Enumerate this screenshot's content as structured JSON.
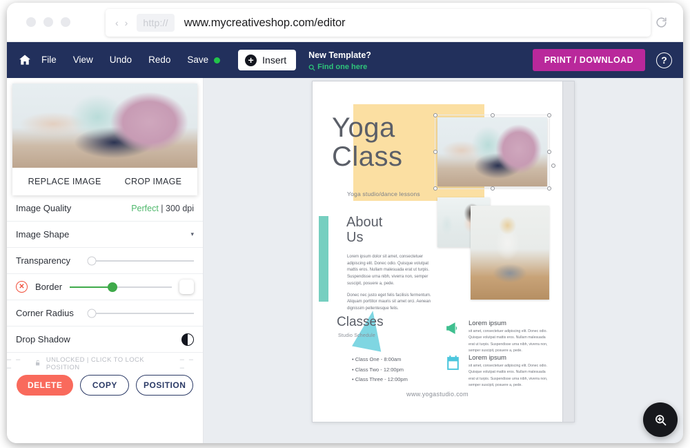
{
  "browser": {
    "back_icon": "chevron-left-icon",
    "forward_icon": "chevron-right-icon",
    "scheme_chip": "http://",
    "url": "www.mycreativeshop.com/editor",
    "reload_icon": "reload-icon"
  },
  "toolbar": {
    "home_icon": "home-icon",
    "menu": [
      {
        "label": "File"
      },
      {
        "label": "View"
      },
      {
        "label": "Undo"
      },
      {
        "label": "Redo"
      }
    ],
    "save_label": "Save",
    "save_status_color": "#22c44a",
    "insert_label": "Insert",
    "template_title": "New Template?",
    "template_link": "Find one here",
    "print_label": "PRINT / DOWNLOAD",
    "help_label": "?",
    "bg_color": "#22305c",
    "accent_color": "#b9289b",
    "link_color": "#2ec47a"
  },
  "panel": {
    "replace_label": "REPLACE IMAGE",
    "crop_label": "CROP IMAGE",
    "rows": [
      {
        "label": "Image Quality",
        "value_ok": "Perfect",
        "value_rest": " | 300 dpi"
      },
      {
        "label": "Image Shape",
        "caret": "▾"
      },
      {
        "label": "Transparency",
        "slider_percent": 0
      },
      {
        "label": "Border",
        "slider_percent": 42
      },
      {
        "label": "Corner Radius",
        "slider_percent": 0
      },
      {
        "label": "Drop Shadow"
      }
    ],
    "border_disable_icon": "no-color-icon",
    "border_swatch_color": "#ffffff",
    "lock_text": "UNLOCKED | CLICK TO LOCK POSITION",
    "lock_dashes_left": "–  –  –",
    "lock_dashes_right": "–  –  –",
    "buttons": {
      "delete": "DELETE",
      "copy": "COPY",
      "position": "POSITION"
    },
    "delete_color": "#f96a5c",
    "outline_color": "#2b3a66"
  },
  "flyer": {
    "title_line1": "Yoga",
    "title_line2": "Class",
    "subtitle": "Yoga studio/dance lessons",
    "about_title_line1": "About",
    "about_title_line2": "Us",
    "about_p1": "Lorem ipsum dolor sit amet, consectetuer adipiscing elit. Donec odio. Quisque volutpat mattis eros. Nullam malesuada erat ut turpis. Suspendisse urna nibh, viverra non, semper suscipit, posuere a, pede.",
    "about_p2": "Donec nec justo eget felis facilisis fermentum. Aliquam porttitor mauris sit amet orci. Aenean dignissim pellentesque felis.",
    "classes_title": "Classes",
    "classes_sub": "Studio Schedule",
    "class_items": [
      "• Class One - 8:00am",
      "• Class Two - 12:00pm",
      "• Class Three - 12:00pm"
    ],
    "features": [
      {
        "icon": "megaphone-icon",
        "title": "Lorem ipsum",
        "text": " sit amet, consectetuer adipiscing elit. Donec odio. Quisque volutpat mattis eros. Nullam malesuada erat ut turpis. Suspendisse urna nibh, viverra non, semper suscipit, posuere a, pede."
      },
      {
        "icon": "calendar-icon",
        "title": "Lorem ipsum",
        "text": " sit amet, consectetuer adipiscing elit. Donec odio. Quisque volutpat mattis eros. Nullam malesuada erat ut turpis. Suspendisse urna nibh, viverra non, semper suscipit, posuere a, pede."
      }
    ],
    "website": "www.yogastudio.com",
    "yellow_color": "#fbdfa2",
    "teal_color": "#76cfc0",
    "triangle_color": "#74d2e0"
  },
  "fab": {
    "icon": "zoom-in-icon"
  }
}
